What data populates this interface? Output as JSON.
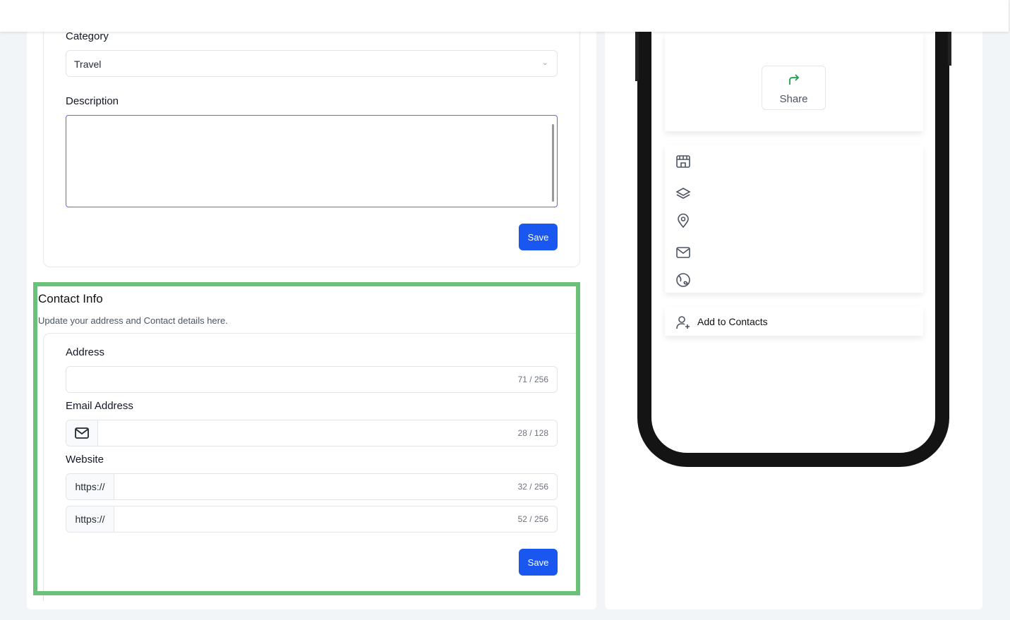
{
  "profile": {
    "category_label": "Category",
    "category_value": "Travel",
    "description_label": "Description",
    "description_value": "",
    "save_label": "Save"
  },
  "contact": {
    "title": "Contact Info",
    "subtitle": "Update your address and Contact details here.",
    "address_label": "Address",
    "address_count": "71 / 256",
    "email_label": "Email Address",
    "email_count": "28 / 128",
    "email_icon": "mail-icon",
    "website_label": "Website",
    "website_prefix": "https://",
    "website1_count": "32 / 256",
    "website2_count": "52 / 256",
    "save_label": "Save"
  },
  "preview": {
    "share_label": "Share",
    "share_color": "#16a34a",
    "icons": [
      "building-icon",
      "layers-icon",
      "map-pin-icon",
      "mail-icon",
      "globe-icon"
    ],
    "add_contacts_label": "Add to Contacts"
  },
  "colors": {
    "primary": "#1a56f0",
    "highlight": "#6cc17a"
  }
}
